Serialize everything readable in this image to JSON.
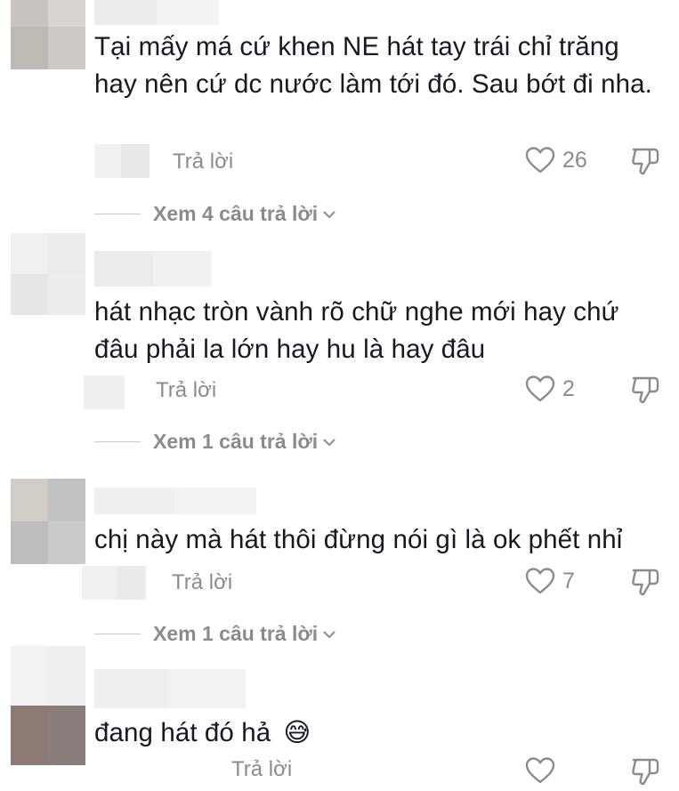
{
  "comments": [
    {
      "text": "Tại mấy má cứ khen NE hát tay trái chỉ trăng hay nên cứ dc nước làm tới đó. Sau bớt đi nha.",
      "reply_label": "Trả lời",
      "likes": "26",
      "view_replies": "Xem 4 câu trả lời"
    },
    {
      "text": "hát nhạc tròn vành rõ chữ nghe mới hay chứ đâu phải la lớn hay hu là hay đâu",
      "reply_label": "Trả lời",
      "likes": "2",
      "view_replies": "Xem 1 câu trả lời"
    },
    {
      "text": "chị này mà hát thôi đừng nói gì là ok phết nhỉ",
      "reply_label": "Trả lời",
      "likes": "7",
      "view_replies": "Xem 1 câu trả lời"
    },
    {
      "text": "đang hát đó hả",
      "emoji": "😅",
      "reply_label": "Trả lời"
    }
  ],
  "icons": {
    "like": "heart-outline-icon",
    "dislike": "thumbs-down-outline-icon",
    "expand": "chevron-down-icon"
  },
  "colors": {
    "text": "#161823",
    "secondary": "#8a8b91",
    "divider": "#c9c9cc"
  }
}
